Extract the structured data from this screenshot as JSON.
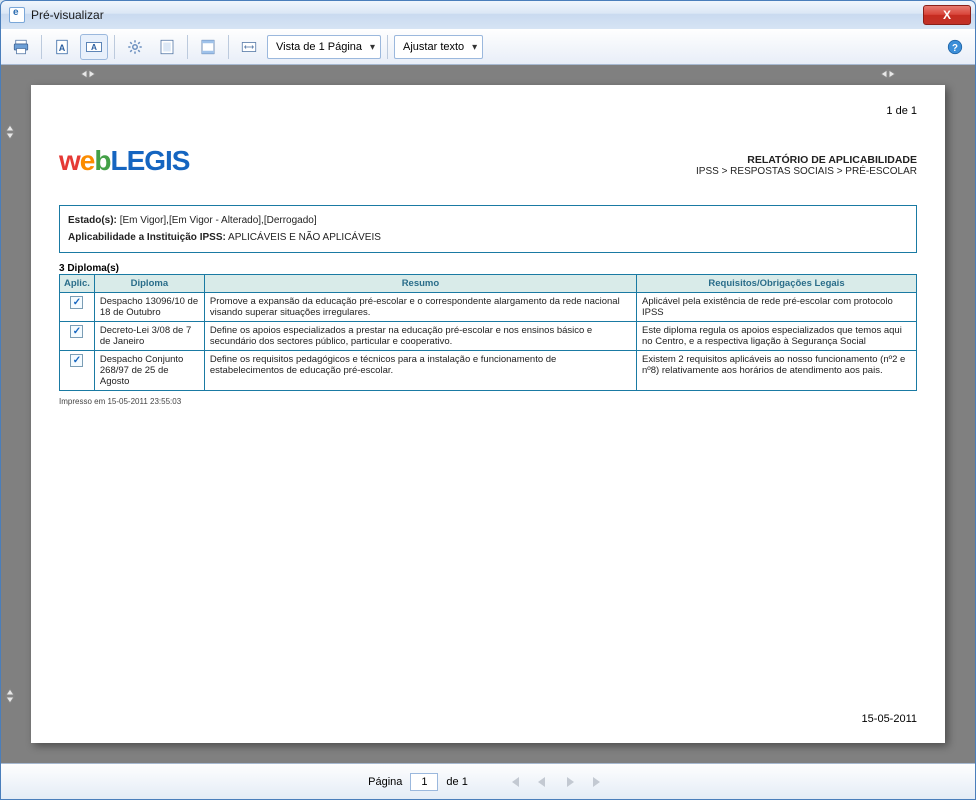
{
  "window": {
    "title": "Pré-visualizar"
  },
  "toolbar": {
    "view_mode": "Vista de 1 Página",
    "fit_mode": "Ajustar texto"
  },
  "page_indicator_top": "1 de 1",
  "report": {
    "title": "RELATÓRIO DE APLICABILIDADE",
    "breadcrumb": "IPSS > RESPOSTAS SOCIAIS > PRÉ-ESCOLAR"
  },
  "filters": {
    "estado_label": "Estado(s):",
    "estado_value": "[Em Vigor],[Em Vigor - Alterado],[Derrogado]",
    "aplic_label": "Aplicabilidade a Instituição IPSS:",
    "aplic_value": "APLICÁVEIS E NÃO APLICÁVEIS"
  },
  "diplomas_count_label": "3 Diploma(s)",
  "table": {
    "headers": {
      "aplic": "Aplic.",
      "diploma": "Diploma",
      "resumo": "Resumo",
      "req": "Requisitos/Obrigações Legais"
    },
    "rows": [
      {
        "aplic": true,
        "diploma": "Despacho 13096/10 de 18 de Outubro",
        "resumo": "Promove a expansão da educação pré-escolar e o correspondente alargamento da rede nacional visando superar situações irregulares.",
        "req": "Aplicável pela existência de rede pré-escolar com protocolo IPSS"
      },
      {
        "aplic": true,
        "diploma": "Decreto-Lei 3/08 de 7 de Janeiro",
        "resumo": "Define os apoios especializados a prestar na educação pré-escolar e nos ensinos básico e secundário dos sectores público, particular e cooperativo.",
        "req": "Este diploma regula os apoios especializados que temos aqui no Centro, e a respectiva ligação à Segurança Social"
      },
      {
        "aplic": true,
        "diploma": "Despacho Conjunto 268/97 de 25 de Agosto",
        "resumo": "Define os requisitos pedagógicos e técnicos para a instalação e funcionamento de estabelecimentos de educação pré-escolar.",
        "req": "Existem 2 requisitos aplicáveis ao nosso funcionamento (nº2 e nº8) relativamente aos horários de atendimento aos pais."
      }
    ]
  },
  "print_timestamp": "Impresso em 15-05-2011 23:55:03",
  "footer_date": "15-05-2011",
  "pager": {
    "label_pre": "Página",
    "value": "1",
    "label_post": "de 1"
  }
}
